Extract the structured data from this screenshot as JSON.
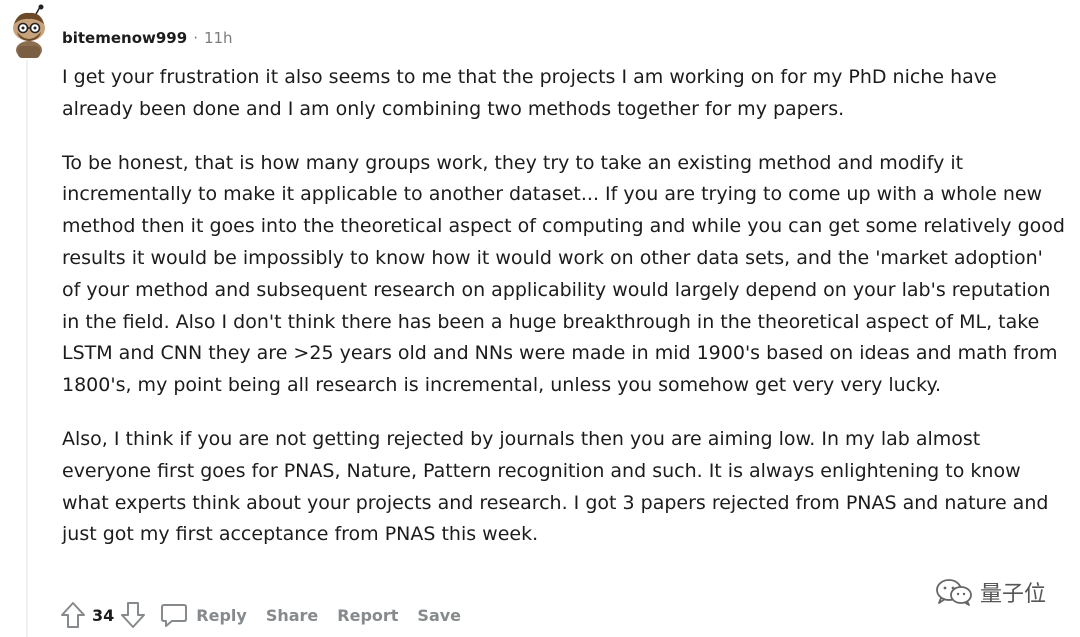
{
  "comment": {
    "author": "bitemenow999",
    "separator": "·",
    "time": "11h",
    "paragraphs": [
      "I get your frustration it also seems to me that the projects I am working on for my PhD niche have already been done and I am only combining two methods together for my papers.",
      "To be honest, that is how many groups work, they try to take an existing method and modify it incrementally to make it applicable to another dataset... If you are trying to come up with a whole new method then it goes into the theoretical aspect of computing and while you can get some relatively good results it would be impossibly to know how it would work on other data sets, and the 'market adoption' of your method and subsequent research on applicability would largely depend on your lab's reputation in the field. Also I don't think there has been a huge breakthrough in the theoretical aspect of ML, take LSTM and CNN they are >25 years old and NNs were made in mid 1900's based on ideas and math from 1800's, my point being all research is incremental, unless you somehow get very very lucky.",
      "Also, I think if you are not getting rejected by journals then you are aiming low. In my lab almost everyone first goes for PNAS, Nature, Pattern recognition and such. It is always enlightening to know what experts think about your projects and research. I got 3 papers rejected from PNAS and nature and just got my first acceptance from PNAS this week."
    ]
  },
  "actions": {
    "score": "34",
    "reply": "Reply",
    "share": "Share",
    "report": "Report",
    "save": "Save"
  },
  "watermark": {
    "text": "量子位",
    "icon": "wechat-icon"
  },
  "colors": {
    "text": "#1c1c1c",
    "meta": "#7c7c7c",
    "action": "#878a8c",
    "thread_line": "#edeff1"
  }
}
